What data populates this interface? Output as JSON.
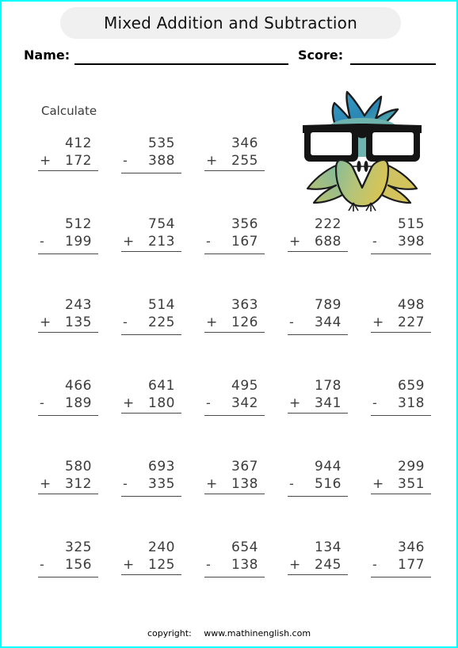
{
  "worksheet": {
    "title": "Mixed Addition and Subtraction",
    "instruction": "Calculate",
    "name_label": "Name:",
    "score_label": "Score:",
    "accent_border_color": "#00ffff",
    "title_pill_color": "#f0f0f0"
  },
  "footer": {
    "copyright_label": "copyright:",
    "site": "www.mathinenglish.com"
  },
  "illustration": {
    "name": "owl-with-glasses",
    "crest_color": "#2f8fbe",
    "crest_color_2": "#58b0ae",
    "body_color_left": "#8fbd8f",
    "body_color_right": "#d6c457",
    "wing_color_left": "#7fb8a8",
    "wing_color_right": "#cfc060",
    "glasses_color": "#1a1a1a",
    "lens_color": "#ffffff"
  },
  "problems": [
    [
      {
        "top": "412",
        "op": "+",
        "bottom": "172"
      },
      {
        "top": "535",
        "op": "-",
        "bottom": "388"
      },
      {
        "top": "346",
        "op": "+",
        "bottom": "255"
      }
    ],
    [
      {
        "top": "512",
        "op": "-",
        "bottom": "199"
      },
      {
        "top": "754",
        "op": "+",
        "bottom": "213"
      },
      {
        "top": "356",
        "op": "-",
        "bottom": "167"
      },
      {
        "top": "222",
        "op": "+",
        "bottom": "688"
      },
      {
        "top": "515",
        "op": "-",
        "bottom": "398"
      }
    ],
    [
      {
        "top": "243",
        "op": "+",
        "bottom": "135"
      },
      {
        "top": "514",
        "op": "-",
        "bottom": "225"
      },
      {
        "top": "363",
        "op": "+",
        "bottom": "126"
      },
      {
        "top": "789",
        "op": "-",
        "bottom": "344"
      },
      {
        "top": "498",
        "op": "+",
        "bottom": "227"
      }
    ],
    [
      {
        "top": "466",
        "op": "-",
        "bottom": "189"
      },
      {
        "top": "641",
        "op": "+",
        "bottom": "180"
      },
      {
        "top": "495",
        "op": "-",
        "bottom": "342"
      },
      {
        "top": "178",
        "op": "+",
        "bottom": "341"
      },
      {
        "top": "659",
        "op": "-",
        "bottom": "318"
      }
    ],
    [
      {
        "top": "580",
        "op": "+",
        "bottom": "312"
      },
      {
        "top": "693",
        "op": "-",
        "bottom": "335"
      },
      {
        "top": "367",
        "op": "+",
        "bottom": "138"
      },
      {
        "top": "944",
        "op": "-",
        "bottom": "516"
      },
      {
        "top": "299",
        "op": "+",
        "bottom": "351"
      }
    ],
    [
      {
        "top": "325",
        "op": "-",
        "bottom": "156"
      },
      {
        "top": "240",
        "op": "+",
        "bottom": "125"
      },
      {
        "top": "654",
        "op": "-",
        "bottom": "138"
      },
      {
        "top": "134",
        "op": "+",
        "bottom": "245"
      },
      {
        "top": "346",
        "op": "-",
        "bottom": "177"
      }
    ]
  ]
}
